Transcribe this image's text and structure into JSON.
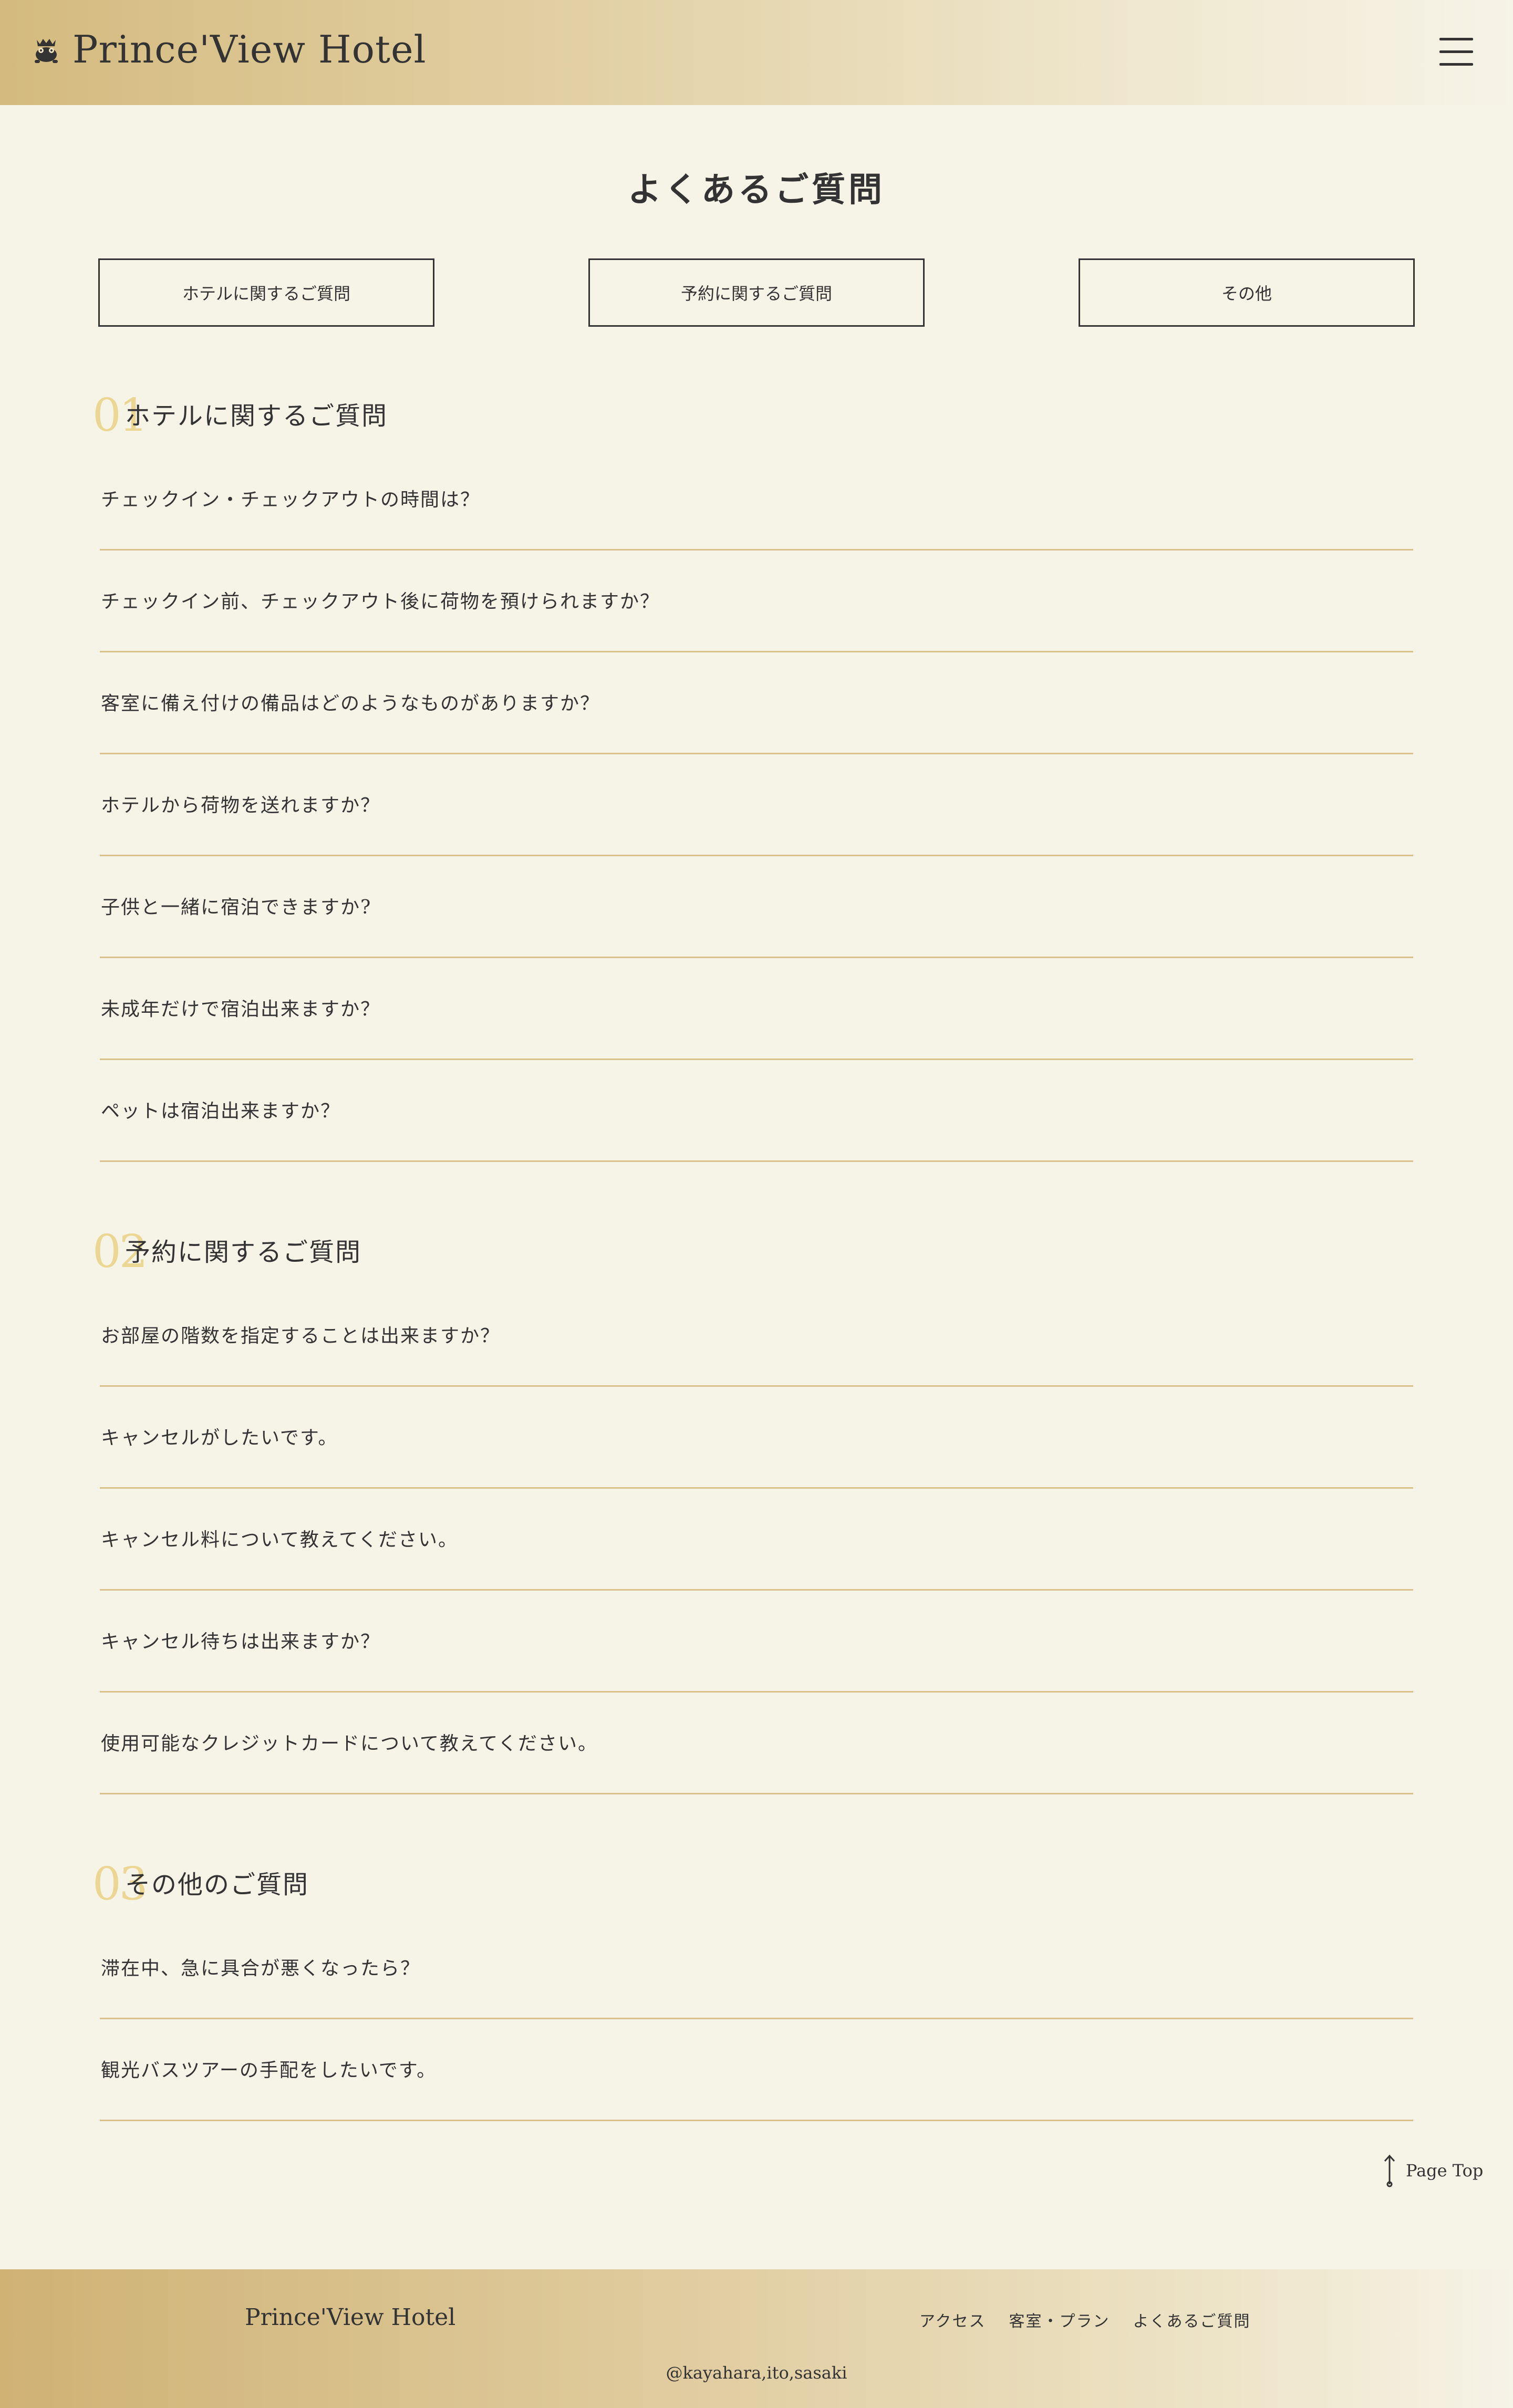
{
  "header": {
    "logo_text": "Prince'View Hotel",
    "logo_icon": "crown-frog-icon",
    "menu_icon": "hamburger-menu-icon"
  },
  "main": {
    "title": "よくあるご質問",
    "tabs": [
      {
        "label": "ホテルに関するご質問"
      },
      {
        "label": "予約に関するご質問"
      },
      {
        "label": "その他"
      }
    ],
    "sections": [
      {
        "number": "01",
        "title": "ホテルに関するご質問",
        "questions": [
          "チェックイン・チェックアウトの時間は？",
          "チェックイン前、チェックアウト後に荷物を預けられますか？",
          "客室に備え付けの備品はどのようなものがありますか？",
          "ホテルから荷物を送れますか？",
          "子供と一緒に宿泊できますか?",
          "未成年だけで宿泊出来ますか？",
          "ペットは宿泊出来ますか？"
        ]
      },
      {
        "number": "02",
        "title": "予約に関するご質問",
        "questions": [
          "お部屋の階数を指定することは出来ますか？",
          "キャンセルがしたいです。",
          "キャンセル料について教えてください。",
          "キャンセル待ちは出来ますか？",
          "使用可能なクレジットカードについて教えてください。"
        ]
      },
      {
        "number": "03",
        "title": "その他のご質問",
        "questions": [
          "滞在中、急に具合が悪くなったら？",
          "観光バスツアーの手配をしたいです。"
        ]
      }
    ],
    "page_top_label": "Page Top",
    "page_top_icon": "arrow-up-icon"
  },
  "footer": {
    "logo_text": "Prince'View Hotel",
    "nav": [
      "アクセス",
      "客室・プラン",
      "よくあるご質問"
    ],
    "copyright": "@kayahara,ito,sasaki"
  },
  "colors": {
    "background": "#f6f3e7",
    "gold": "#d4ba7e",
    "number_accent": "#ecd693",
    "divider": "#dcc08c"
  }
}
